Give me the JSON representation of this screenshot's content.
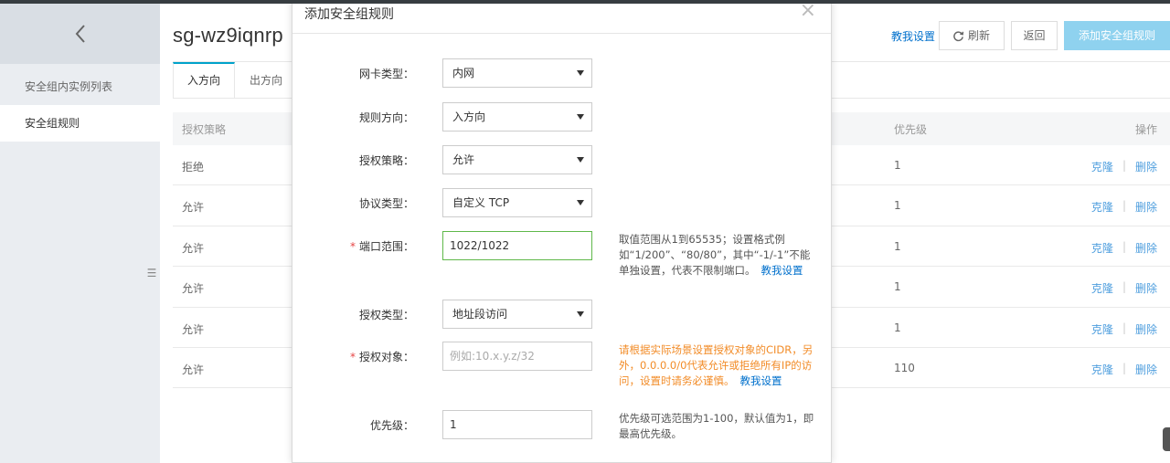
{
  "sidebar": {
    "items": [
      {
        "label": "安全组内实例列表",
        "active": false
      },
      {
        "label": "安全组规则",
        "active": true
      }
    ]
  },
  "header": {
    "title": "sg-wz9iqnrp",
    "help_link": "教我设置",
    "refresh_label": "刷新",
    "back_label": "返回",
    "add_rule_label": "添加安全组规则"
  },
  "tabs": [
    {
      "label": "入方向",
      "active": true
    },
    {
      "label": "出方向",
      "active": false
    }
  ],
  "table": {
    "columns": {
      "policy": "授权策略",
      "priority": "优先级",
      "actions": "操作"
    },
    "rows": [
      {
        "policy": "拒绝",
        "priority": "1"
      },
      {
        "policy": "允许",
        "priority": "1"
      },
      {
        "policy": "允许",
        "priority": "1"
      },
      {
        "policy": "允许",
        "priority": "1"
      },
      {
        "policy": "允许",
        "priority": "1"
      },
      {
        "policy": "允许",
        "priority": "110"
      }
    ],
    "clone_label": "克隆",
    "delete_label": "删除",
    "sep": "|"
  },
  "modal": {
    "title": "添加安全组规则",
    "close": "×",
    "fields": {
      "nic_type": {
        "label": "网卡类型：",
        "value": "内网"
      },
      "direction": {
        "label": "规则方向：",
        "value": "入方向"
      },
      "policy": {
        "label": "授权策略：",
        "value": "允许"
      },
      "protocol": {
        "label": "协议类型：",
        "value": "自定义 TCP"
      },
      "port_range": {
        "required": "*",
        "label": "端口范围：",
        "value": "1022/1022",
        "hint": "取值范围从1到65535；设置格式例如“1/200”、“80/80”，其中“-1/-1”不能单独设置，代表不限制端口。",
        "hint_link": "教我设置"
      },
      "auth_type": {
        "label": "授权类型：",
        "value": "地址段访问"
      },
      "auth_object": {
        "required": "*",
        "label": "授权对象：",
        "placeholder": "例如:10.x.y.z/32",
        "hint": "请根据实际场景设置授权对象的CIDR，另外，0.0.0.0/0代表允许或拒绝所有IP的访问，设置时请务必谨慎。",
        "hint_link": "教我设置"
      },
      "priority": {
        "label": "优先级：",
        "value": "1",
        "hint": "优先级可选范围为1-100，默认值为1，即最高优先级。"
      }
    }
  },
  "colors": {
    "primary_button": "#8fd2ef",
    "link": "#0070cc",
    "warning_text": "#f28c28",
    "focus_border": "#5fb84a",
    "required": "#e64545"
  }
}
